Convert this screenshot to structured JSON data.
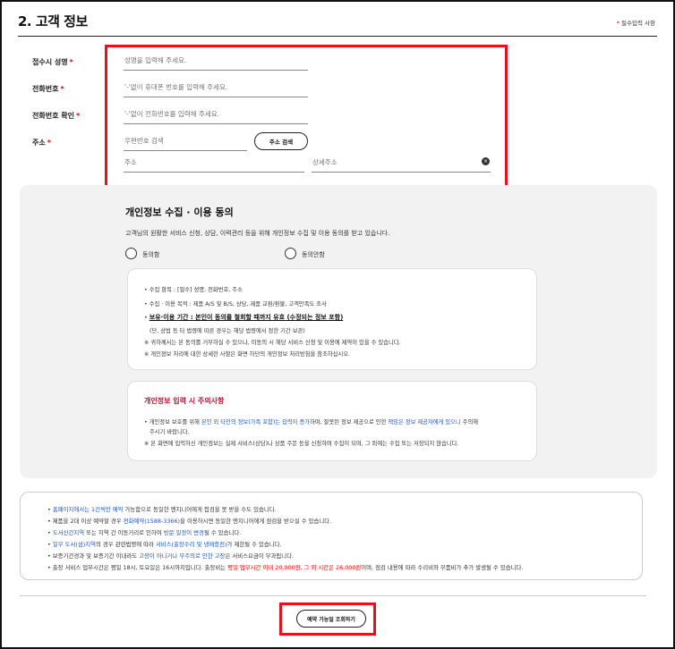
{
  "section": {
    "title": "2. 고객 정보",
    "required_note_star": "*",
    "required_note": "필수입력 사항"
  },
  "form": {
    "name_label": "접수시 성명",
    "name_placeholder": "성명을 입력해 주세요.",
    "phone_label": "전화번호",
    "phone_placeholder": "'-'없이 휴대폰 번호를 입력해 주세요.",
    "phone_confirm_label": "전화번호 확인",
    "phone_confirm_placeholder": "'-'없이 전화번호를 입력해 주세요.",
    "address_label": "주소",
    "postcode_placeholder": "우편번호 검색",
    "address_search_button": "주소 검색",
    "address_placeholder": "주소",
    "address_detail_placeholder": "상세주소",
    "required_star": "*"
  },
  "consent": {
    "title": "개인정보 수집 · 이용 동의",
    "description": "고객님의 원활한 서비스 신청, 상담, 이력관리 등을 위해 개인정보 수집 및 이용 동의를 받고 있습니다.",
    "agree_label": "동의함",
    "disagree_label": "동의안함",
    "items": {
      "item1": "• 수집 항목 : [필수] 성명, 전화번호, 주소",
      "item2": "• 수집 · 이용 목적 : 제품 A/S 및 B/S, 상담, 제품 교환/환불, 고객만족도 조사",
      "item3": "보유·이용 기간 : 본인이 동의를 철회할 때까지 유효 (수정되는 정보 포함)",
      "item3_prefix": "• ",
      "item3_sub": "(단, 상법 등 타 법령에 따른 경우는 해당 법령에서 정한 기간 보관)",
      "item4": "※ 귀하께서는 본 동의를 거부하실 수 있으나, 미동의 시 해당 서비스 신청 및 이용에 제약이 있을 수 있습니다.",
      "item5": "※ 개인정보 처리에 대한 상세한 사항은 화면 하단의 개인정보 처리방침을 참조하십시오."
    },
    "warning": {
      "title": "개인정보 입력 시 주의사항",
      "line1a": "• 개인정보 보호를 위해 ",
      "line1b": "본인 외 타인의 정보(가족 포함)는 입력이 증가",
      "line1c": "하며, 잘못된 정보 제공으로 인한 ",
      "line1d": "책임은 정보 제공자에게 있으니",
      "line1e": " 주의해",
      "line1f": "주시기 바랍니다.",
      "line2": "※ 본 화면에 입력하신 개인정보는 실제 서비스(상담)나 상품 주문 등을 신청하며 수집이 되며, 그 외에는 수집 또는 저장되지 않습니다."
    }
  },
  "notice": {
    "n1a": "• ",
    "n1b": "홈페이지에서는 1건씩만 예약",
    "n1c": " 가능함으로 동일한 엔지니어에게 접검을 못 받을 수도 있습니다.",
    "n2a": "• 제품을 2대 이상 예약할 경우 ",
    "n2b": "전화예약(1588-3366)",
    "n2c": "을 이용하시면 동일한 엔지니어에게 점검을 받으실 수 있습니다.",
    "n3a": "• ",
    "n3b": "도서산간지역",
    "n3c": " 또는 지역 간 이동거리로 인하여 ",
    "n3d": "방문 일정이 변경",
    "n3e": "될 수 있습니다.",
    "n4a": "• ",
    "n4b": "일부 도서(섬)지역",
    "n4c": "의 경우 관련법령에 따라 ",
    "n4d": "서비스(출장수리 및 냉매충전)",
    "n4e": "가 제한될 수 있습니다.",
    "n5a": "• 보증기간경과 및 보증기간 이내라도 ",
    "n5b": "고장이 아니거나 부주의로 인한 고장",
    "n5c": "은 서비스요금이 부과됩니다.",
    "n6a": "• 출장 서비스 업무시간은 평일 18시, 토요일은 16시까지입니다. 출장비는 ",
    "n6b": "평일 업무시간 이내 20,000원, 그 외 시간은 26,000원",
    "n6c": "이며, 점검 내용에 따라 수리비와 부품비가 추가 발생될 수 있습니다."
  },
  "actions": {
    "check_button": "예약 가능일 조회하기"
  },
  "colors": {
    "accent_red": "#e3121d",
    "link_blue": "#1a57c9",
    "warning_title": "#c0133a"
  }
}
